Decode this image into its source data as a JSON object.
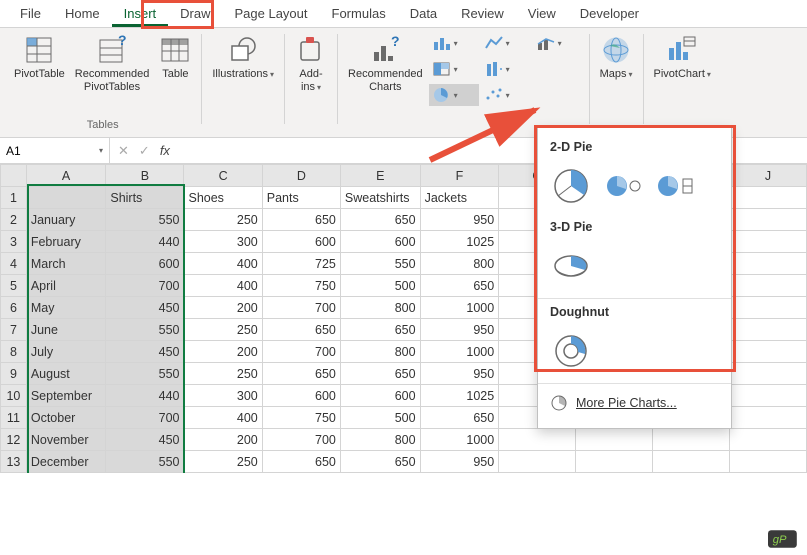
{
  "tabs": [
    "File",
    "Home",
    "Insert",
    "Draw",
    "Page Layout",
    "Formulas",
    "Data",
    "Review",
    "View",
    "Developer"
  ],
  "active_tab": "Insert",
  "ribbon": {
    "pivot": "PivotTable",
    "rec_pivot": "Recommended\nPivotTables",
    "table": "Table",
    "group_tables": "Tables",
    "illus": "Illustrations",
    "addins": "Add-\nins",
    "rec_charts": "Recommended\nCharts",
    "maps": "Maps",
    "pivotchart": "PivotChart"
  },
  "name_box": "A1",
  "fx_label": "fx",
  "columns": [
    "A",
    "B",
    "C",
    "D",
    "E",
    "F",
    "G",
    "H",
    "I",
    "J"
  ],
  "headers": [
    "",
    "Shirts",
    "Shoes",
    "Pants",
    "Sweatshirts",
    "Jackets"
  ],
  "rows": [
    [
      "January",
      550,
      250,
      650,
      650,
      950
    ],
    [
      "February",
      440,
      300,
      600,
      600,
      1025
    ],
    [
      "March",
      600,
      400,
      725,
      550,
      800
    ],
    [
      "April",
      700,
      400,
      750,
      500,
      650
    ],
    [
      "May",
      450,
      200,
      700,
      800,
      1000
    ],
    [
      "June",
      550,
      250,
      650,
      650,
      950
    ],
    [
      "July",
      450,
      200,
      700,
      800,
      1000
    ],
    [
      "August",
      550,
      250,
      650,
      650,
      950
    ],
    [
      "September",
      440,
      300,
      600,
      600,
      1025
    ],
    [
      "October",
      700,
      400,
      750,
      500,
      650
    ],
    [
      "November",
      450,
      200,
      700,
      800,
      1000
    ],
    [
      "December",
      550,
      250,
      650,
      650,
      950
    ]
  ],
  "pie_menu": {
    "sec1": "2-D Pie",
    "sec2": "3-D Pie",
    "sec3": "Doughnut",
    "more": "More Pie Charts..."
  }
}
